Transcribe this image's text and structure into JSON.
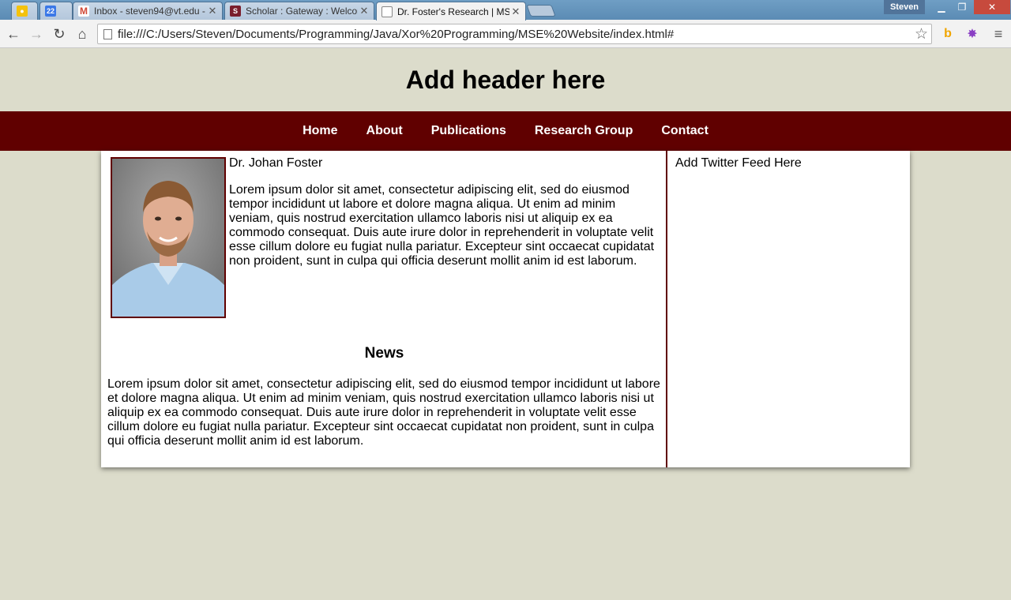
{
  "browser": {
    "tabs": [
      {
        "title": "",
        "favicon": "lightbulb-icon"
      },
      {
        "title": "",
        "favicon": "calendar-icon",
        "badge": "22"
      },
      {
        "title": "Inbox - steven94@vt.edu -",
        "favicon": "gmail-icon"
      },
      {
        "title": "Scholar : Gateway : Welcome",
        "favicon": "scholar-icon"
      },
      {
        "title": "Dr. Foster's Research | MSE",
        "favicon": "page-icon",
        "active": true
      }
    ],
    "profile_name": "Steven",
    "url": "file:///C:/Users/Steven/Documents/Programming/Java/Xor%20Programming/MSE%20Website/index.html#"
  },
  "site": {
    "header": "Add header here",
    "nav": [
      "Home",
      "About",
      "Publications",
      "Research Group",
      "Contact"
    ],
    "bio_name": "Dr. Johan Foster",
    "bio_text": "Lorem ipsum dolor sit amet, consectetur adipiscing elit, sed do eiusmod tempor incididunt ut labore et dolore magna aliqua. Ut enim ad minim veniam, quis nostrud exercitation ullamco laboris nisi ut aliquip ex ea commodo consequat. Duis aute irure dolor in reprehenderit in voluptate velit esse cillum dolore eu fugiat nulla pariatur. Excepteur sint occaecat cupidatat non proident, sunt in culpa qui officia deserunt mollit anim id est laborum.",
    "news_title": "News",
    "news_text": "Lorem ipsum dolor sit amet, consectetur adipiscing elit, sed do eiusmod tempor incididunt ut labore et dolore magna aliqua. Ut enim ad minim veniam, quis nostrud exercitation ullamco laboris nisi ut aliquip ex ea commodo consequat. Duis aute irure dolor in reprehenderit in voluptate velit esse cillum dolore eu fugiat nulla pariatur. Excepteur sint occaecat cupidatat non proident, sunt in culpa qui officia deserunt mollit anim id est laborum.",
    "twitter_placeholder": "Add Twitter Feed Here"
  },
  "colors": {
    "maroon": "#600000",
    "page_bg": "#dcdccb"
  }
}
